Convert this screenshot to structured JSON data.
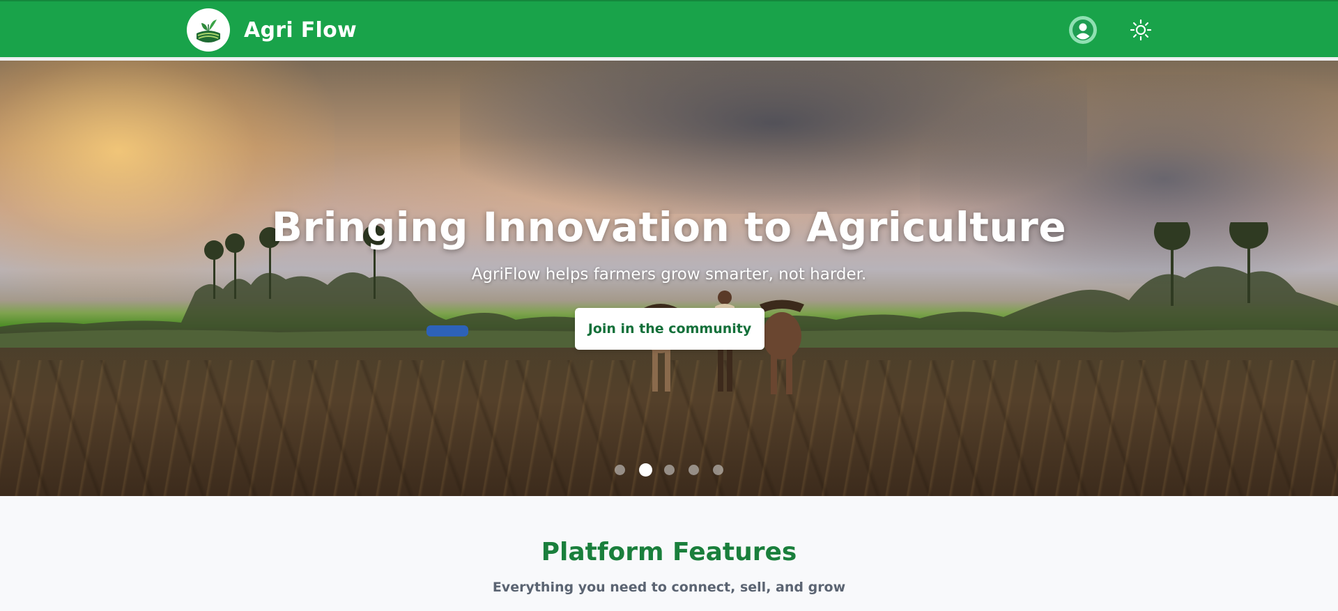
{
  "header": {
    "brand": "Agri Flow",
    "logo_icon": "leaf-field-logo-icon",
    "user_icon": "user-circle-icon",
    "theme_icon": "sun-icon",
    "colors": {
      "bar": "#19a34a",
      "user_bg": "#8fe0b2"
    }
  },
  "hero": {
    "title": "Bringing Innovation to Agriculture",
    "subtitle": "AgriFlow helps farmers grow smarter, not harder.",
    "cta_label": "Join in the community",
    "carousel": {
      "slide_count": 5,
      "active_index": 1
    }
  },
  "features": {
    "title": "Platform Features",
    "subtitle": "Everything you need to connect, sell, and grow",
    "title_color": "#1a7f3c"
  }
}
